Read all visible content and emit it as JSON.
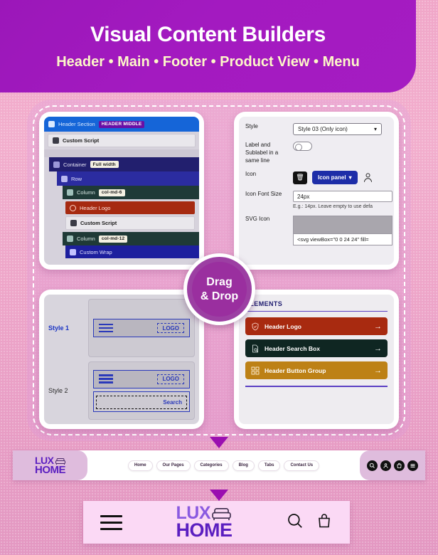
{
  "hero": {
    "title": "Visual Content Builders",
    "subtitle": "Header • Main • Footer • Product View • Menu"
  },
  "badge": {
    "line1": "Drag",
    "line2": "& Drop"
  },
  "builder_tree": {
    "rows": [
      {
        "label": "Header Section",
        "badge": "HEADER MIDDLE",
        "icon": "section-icon"
      },
      {
        "label": "Custom Script",
        "badge": "",
        "icon": "script-icon"
      },
      {
        "label": "Container",
        "badge": "Full width",
        "icon": "container-icon"
      },
      {
        "label": "Row",
        "badge": "",
        "icon": "row-icon"
      },
      {
        "label": "Column",
        "badge": "col-md-6",
        "icon": "column-icon"
      },
      {
        "label": "Header Logo",
        "badge": "",
        "icon": "shield-check-icon"
      },
      {
        "label": "Custom Script",
        "badge": "",
        "icon": "script-icon"
      },
      {
        "label": "Column",
        "badge": "col-md-12",
        "icon": "column-icon"
      },
      {
        "label": "Custom Wrap",
        "badge": "",
        "icon": "wrap-icon"
      }
    ]
  },
  "settings": {
    "style_label": "Style",
    "style_value": "Style 03 (Only icon)",
    "sameline_label": "Label and Sublabel in a same line",
    "sameline_state": "off",
    "icon_label": "Icon",
    "icon_panel_button": "Icon panel",
    "icon_font_size_label": "Icon Font Size",
    "icon_font_size_value": "24px",
    "icon_font_size_hint": "E.g.: 14px. Leave empty to use defa",
    "svg_icon_label": "SVG Icon",
    "svg_icon_code": "<svg viewBox=\"0 0 24 24\" fill="
  },
  "styles_panel": {
    "items": [
      {
        "label": "Style 1",
        "active": true,
        "logo_text": "LOGO",
        "search_text": ""
      },
      {
        "label": "Style 2",
        "active": false,
        "logo_text": "LOGO",
        "search_text": "Search"
      }
    ]
  },
  "elements_panel": {
    "title": "ELEMENTS",
    "items": [
      {
        "label": "Header Logo",
        "color": "#a82a10",
        "icon": "shield-check-icon",
        "arrow": "→"
      },
      {
        "label": "Header Search Box",
        "color": "#0f2622",
        "icon": "file-search-icon",
        "arrow": "→"
      },
      {
        "label": "Header Button Group",
        "color": "#bd8116",
        "icon": "grid-apps-icon",
        "arrow": "→"
      }
    ]
  },
  "desktop_nav": {
    "logo": {
      "lux": "LUX",
      "home": "HOME"
    },
    "menu": [
      "Home",
      "Our Pages",
      "Categories",
      "Blog",
      "Tabs",
      "Contact Us"
    ],
    "icons": [
      "search-icon",
      "user-icon",
      "bag-icon",
      "menu-icon"
    ]
  },
  "mobile_nav": {
    "logo": {
      "lux": "LUX",
      "home": "HOME"
    },
    "icons": [
      "menu-icon",
      "search-icon",
      "bag-icon"
    ]
  },
  "colors": {
    "hero_purple": "#a31ac0",
    "accent_yellow": "#fdf8c8",
    "page_pink": "#f0a6c8",
    "badge_purple": "#9a2f9f",
    "brand_violet": "#5b1fc0"
  }
}
